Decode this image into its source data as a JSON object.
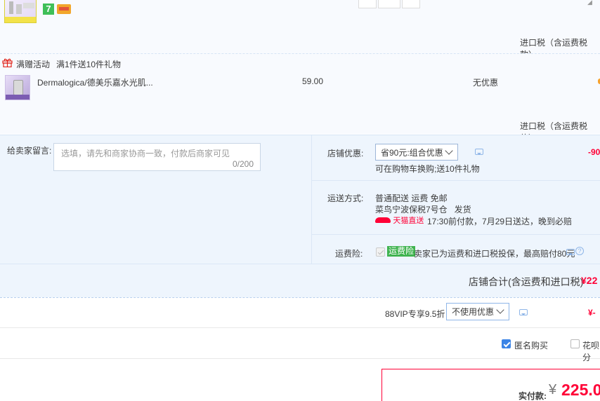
{
  "item1": {
    "badge_number": "7",
    "tax_note": "进口税（含运费税款）"
  },
  "promo": {
    "tag": "满赠活动",
    "desc": "满1件送10件礼物"
  },
  "item2": {
    "name": "Dermalogica/德美乐嘉水光肌...",
    "price": "59.00",
    "discount": "无优惠",
    "tax_note": "进口税（含运费税款）"
  },
  "message": {
    "label": "给卖家留言:",
    "placeholder": "选填，请先和商家协商一致，付款后商家可见",
    "counter": "0/200"
  },
  "shop_discount": {
    "label": "店铺优惠:",
    "selected": "省90元:组合优惠",
    "note": "可在购物车换购;送10件礼物",
    "amount": "-90"
  },
  "shipping": {
    "label": "运送方式:",
    "line1": "普通配送 运费 免邮",
    "line2": "菜鸟宁波保税7号仓   发货",
    "tmall_tag": "天猫直送",
    "promise": "17:30前付款，7月29日送达，晚到必赔"
  },
  "insurance": {
    "label": "运费险:",
    "tag": "运费险",
    "text": "卖家已为运费和进口税投保，最高赔付80元"
  },
  "shop_total": {
    "label": "店铺合计(含运费和进口税)",
    "amount": "¥22"
  },
  "vip": {
    "label": "88VIP专享9.5折",
    "selected": "不使用优惠",
    "amount": "¥-"
  },
  "options": {
    "anonymous": "匿名购买",
    "huabei": "花呗分"
  },
  "payment": {
    "label": "实付款:",
    "currency": "¥",
    "amount": "225.0"
  },
  "colors": {
    "accent_red": "#ff0036",
    "checkbox_blue": "#3b84e6",
    "panel_blue": "#eef5fd"
  }
}
